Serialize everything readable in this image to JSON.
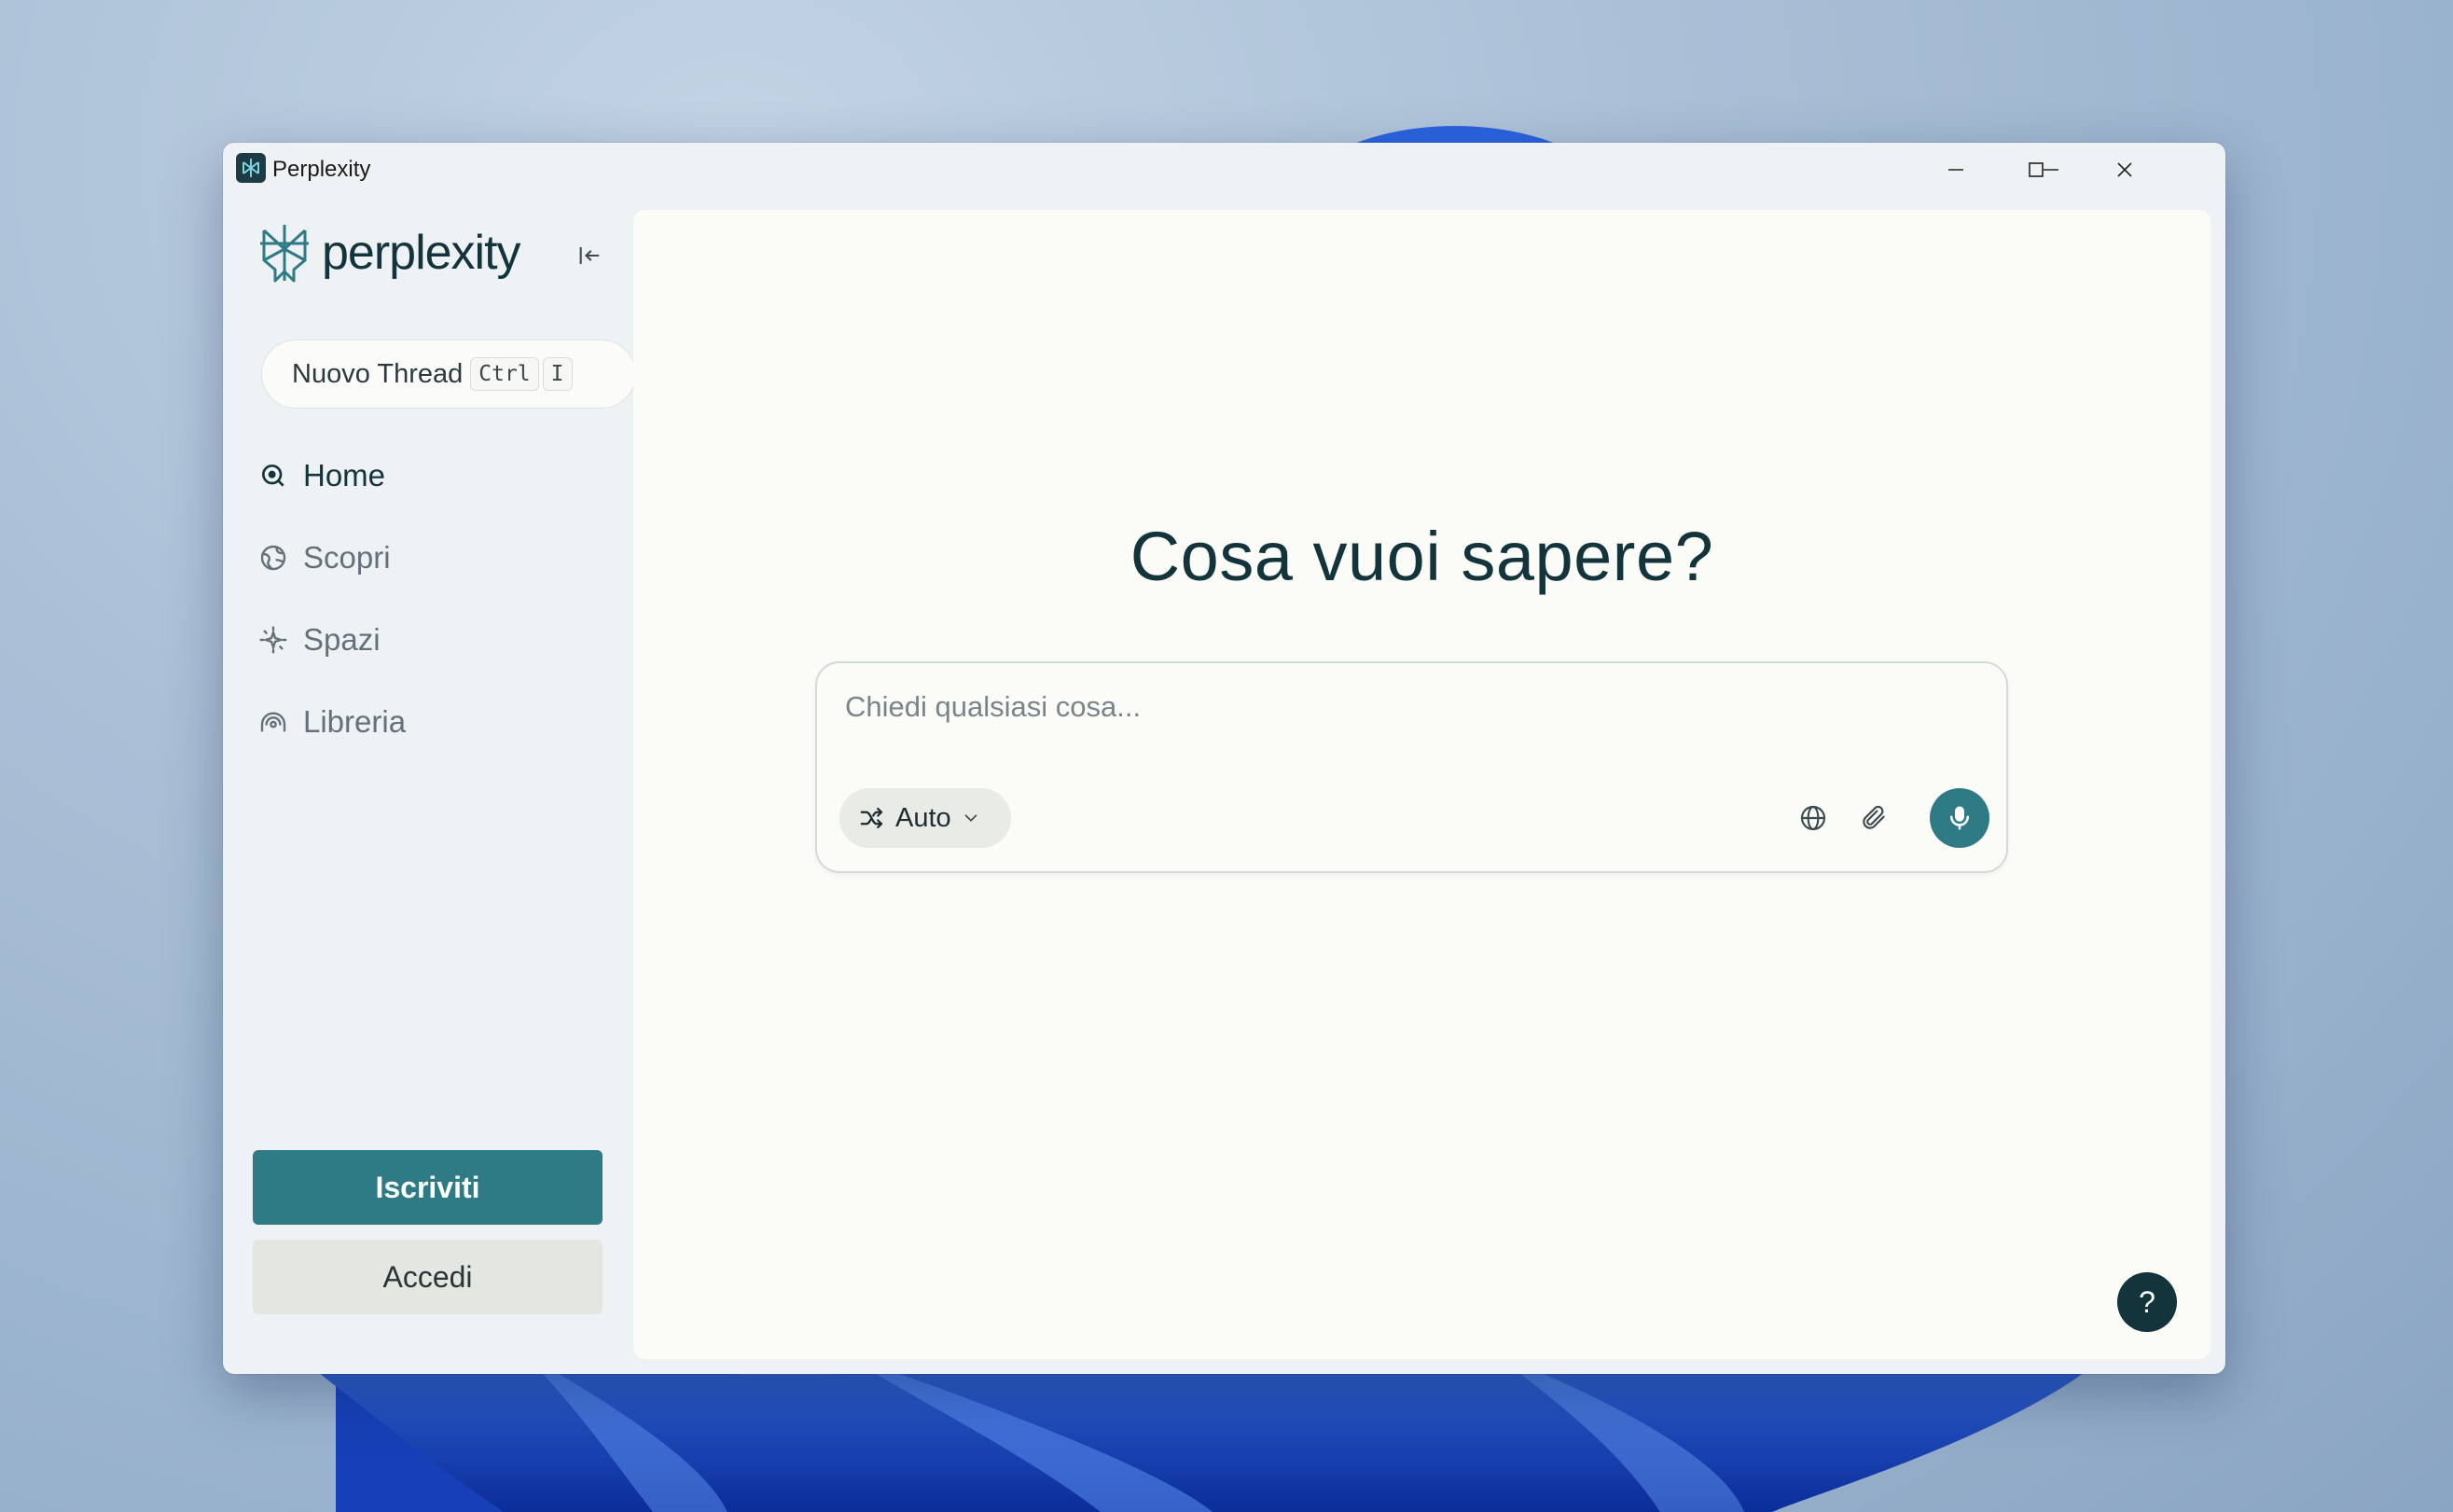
{
  "window": {
    "title": "Perplexity"
  },
  "sidebar": {
    "logo_text": "perplexity",
    "new_thread": {
      "label": "Nuovo Thread",
      "shortcut_keys": [
        "Ctrl",
        "I"
      ]
    },
    "nav_items": [
      {
        "label": "Home",
        "icon": "search-circle-icon",
        "active": true
      },
      {
        "label": "Scopri",
        "icon": "globe-icon",
        "active": false
      },
      {
        "label": "Spazi",
        "icon": "sparkle-icon",
        "active": false
      },
      {
        "label": "Libreria",
        "icon": "library-icon",
        "active": false
      }
    ],
    "signup_label": "Iscriviti",
    "login_label": "Accedi"
  },
  "main": {
    "heading": "Cosa vuoi sapere?",
    "search": {
      "placeholder": "Chiedi qualsiasi cosa..."
    },
    "mode_selector": {
      "value": "Auto",
      "icon": "shuffle-icon"
    },
    "help_label": "?"
  },
  "colors": {
    "accent": "#2e7b86",
    "dark": "#13343b"
  }
}
